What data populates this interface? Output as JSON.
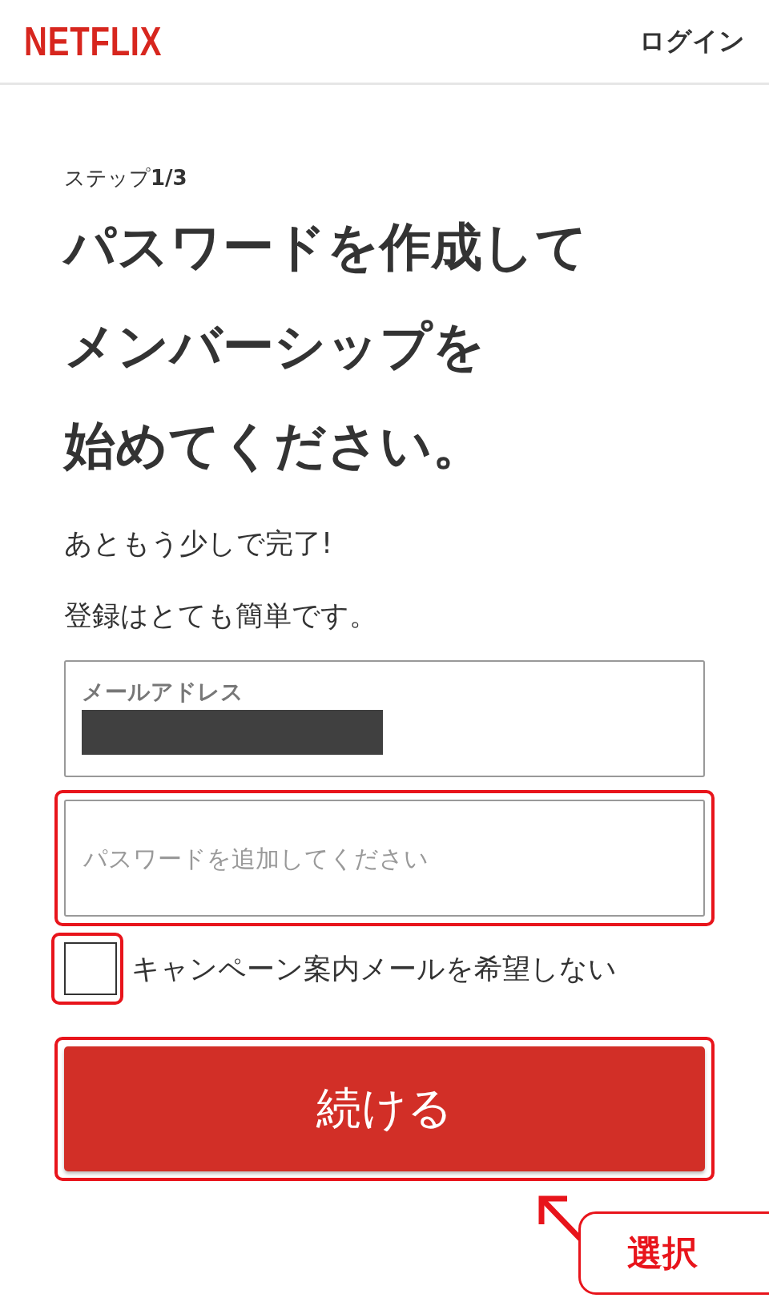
{
  "header": {
    "logo": "NETFLIX",
    "login": "ログイン"
  },
  "step": "ステップ**1/3**",
  "title": [
    "パスワードを作成して",
    "メンバーシップを",
    "始めてください。"
  ],
  "paragraphs": [
    "あともう少しで完了!",
    "登録はとても簡単です。"
  ],
  "fields": [
    {
      "kind": "filled",
      "label": "メールアドレス",
      "redacted": true,
      "highlighted": false
    },
    {
      "kind": "empty",
      "placeholder": "パスワードを追加してください",
      "highlighted": true
    }
  ],
  "checkbox": {
    "label": "キャンペーン案内メールを希望しない",
    "checked": false,
    "highlighted": true
  },
  "button": {
    "label": "続ける",
    "highlighted": true
  },
  "callout": {
    "text": "選択"
  }
}
